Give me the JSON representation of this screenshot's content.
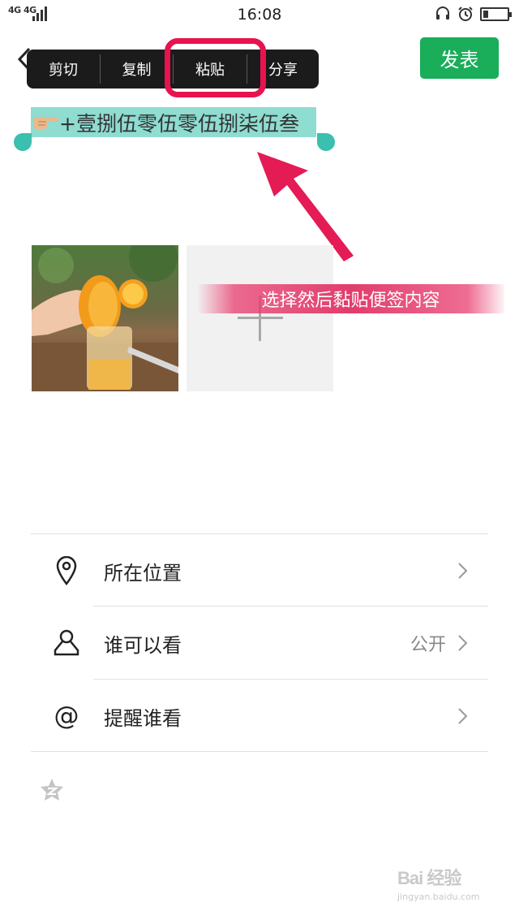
{
  "status_bar": {
    "network": "4G 4G",
    "time": "16:08"
  },
  "header": {
    "publish_label": "发表"
  },
  "context_menu": {
    "items": [
      "剪切",
      "复制",
      "粘贴",
      "分享"
    ],
    "highlighted": "粘贴"
  },
  "post": {
    "text": "+壹捌伍零伍零伍捌柒伍叁"
  },
  "annotation": {
    "banner_text": "选择然后黏贴便签内容",
    "accent_color": "#e8134e"
  },
  "options": [
    {
      "label": "所在位置",
      "value": "",
      "icon": "location-icon"
    },
    {
      "label": "谁可以看",
      "value": "公开",
      "icon": "person-icon"
    },
    {
      "label": "提醒谁看",
      "value": "",
      "icon": "at-icon"
    }
  ],
  "watermark": {
    "brand": "Bai 经验",
    "url": "jingyan.baidu.com"
  },
  "colors": {
    "publish_green": "#1aad5a",
    "selection": "#8fdcd1",
    "handle": "#3bbfae"
  }
}
